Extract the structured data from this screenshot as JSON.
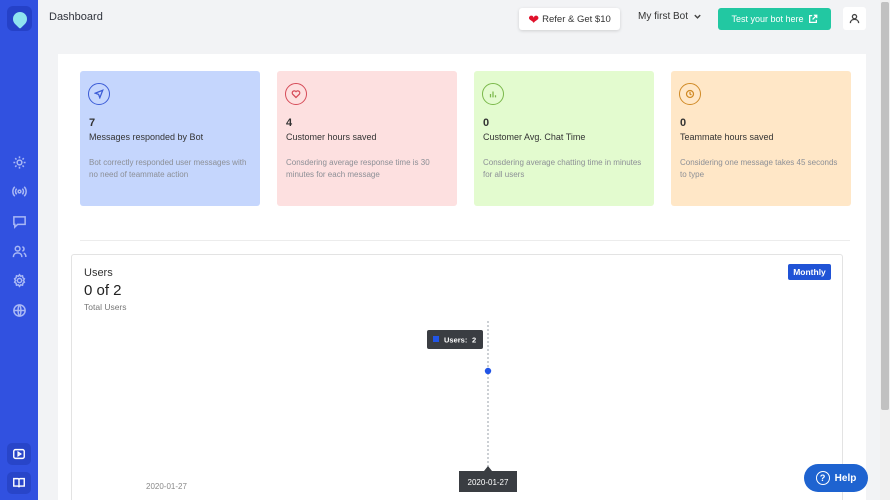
{
  "header": {
    "title": "Dashboard",
    "refer_label": "Refer & Get $10",
    "bot_name": "My first Bot",
    "test_label": "Test your bot here"
  },
  "sidebar": {
    "items": [
      {
        "icon": "settings-icon"
      },
      {
        "icon": "broadcast-icon"
      },
      {
        "icon": "chat-icon"
      },
      {
        "icon": "users-icon"
      },
      {
        "icon": "gear-icon"
      },
      {
        "icon": "globe-icon"
      }
    ],
    "bottom": [
      {
        "icon": "video-icon"
      },
      {
        "icon": "book-icon"
      }
    ]
  },
  "cards": [
    {
      "value": "7",
      "title": "Messages responded by Bot",
      "desc": "Bot correctly responded user messages with no need of teammate action",
      "bg": "#c5d6fd",
      "accent": "#3b5bd6",
      "icon": "send-icon"
    },
    {
      "value": "4",
      "title": "Customer hours saved",
      "desc": "Consdering average response time is 30 minutes for each message",
      "bg": "#fde0e0",
      "accent": "#d64b58",
      "icon": "heart-icon"
    },
    {
      "value": "0",
      "title": "Customer Avg. Chat Time",
      "desc": "Consdering average chatting time in minutes for all users",
      "bg": "#e3fbcf",
      "accent": "#7ab84a",
      "icon": "bar-chart-icon"
    },
    {
      "value": "0",
      "title": "Teammate hours saved",
      "desc": "Considering one message takes 45 seconds to type",
      "bg": "#ffe7c7",
      "accent": "#d08a26",
      "icon": "clock-icon"
    }
  ],
  "users": {
    "title": "Users",
    "value": "0 of 2",
    "subtitle": "Total Users",
    "period_label": "Monthly"
  },
  "chart_data": {
    "type": "line",
    "x": [
      "2020-01-27"
    ],
    "series": [
      {
        "name": "Users",
        "values": [
          2
        ]
      }
    ],
    "tooltip": {
      "label": "Users:",
      "value": "2"
    },
    "x_tooltip": "2020-01-27"
  },
  "help_label": "Help"
}
